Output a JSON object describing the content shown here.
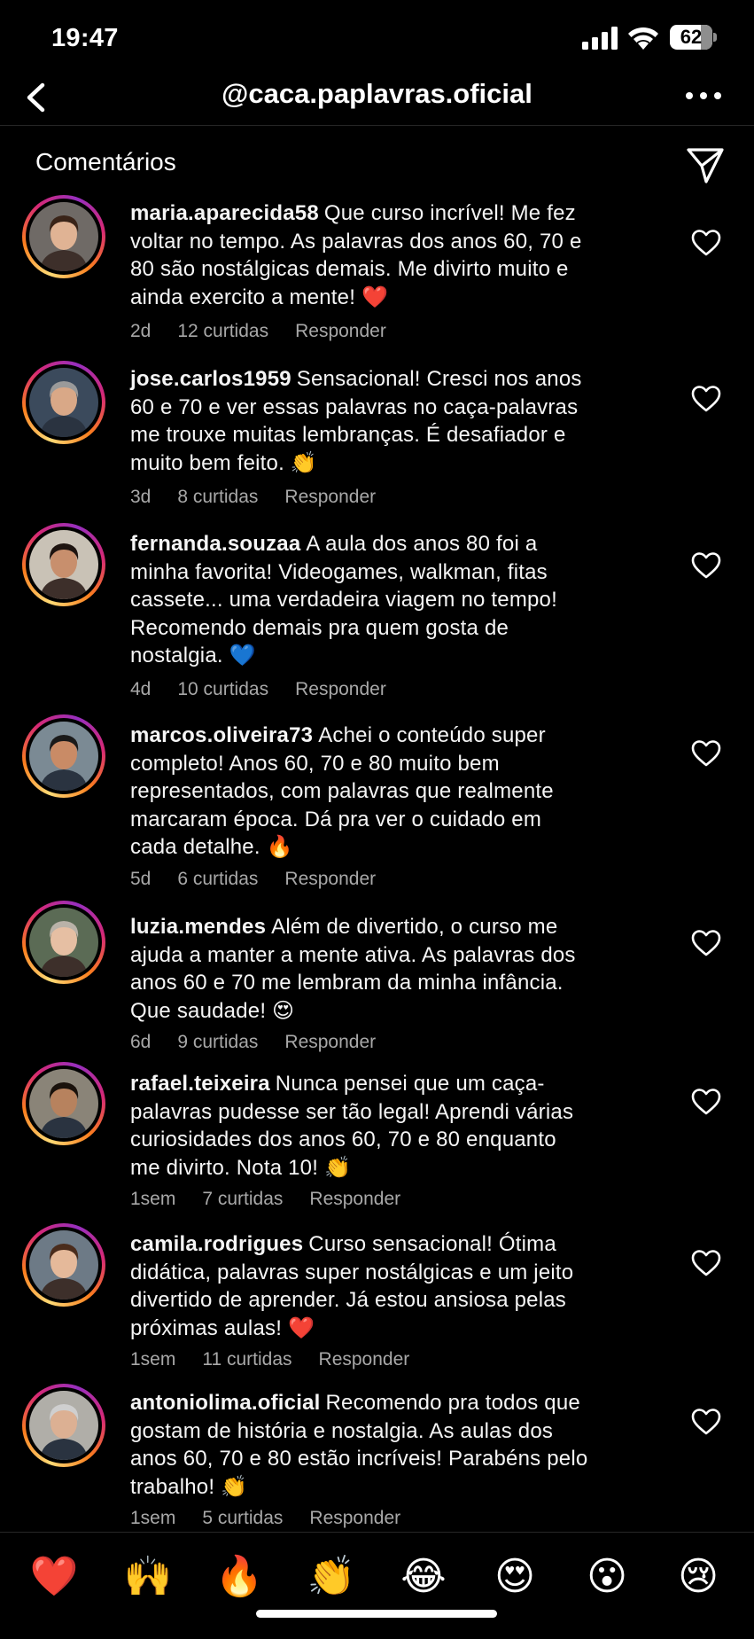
{
  "status_bar": {
    "time": "19:47",
    "battery": "62"
  },
  "header": {
    "title": "@caca.paplavras.oficial"
  },
  "section": {
    "title": "Comentários"
  },
  "comments": [
    {
      "user": "maria.aparecida58",
      "text": "Que curso incrível! Me fez voltar no tempo. As palavras dos anos 60, 70 e 80 são nostálgicas demais. Me divirto muito e ainda exercito a mente! ❤️",
      "time": "2d",
      "likes": "12 curtidas",
      "reply": "Responder"
    },
    {
      "user": "jose.carlos1959",
      "text": "Sensacional! Cresci nos anos 60 e 70 e ver essas palavras no caça-palavras me trouxe muitas lembranças. É desafiador e muito bem feito. 👏",
      "time": "3d",
      "likes": "8 curtidas",
      "reply": "Responder"
    },
    {
      "user": "fernanda.souzaa",
      "text": "A aula dos anos 80 foi a minha favorita! Videogames, walkman, fitas cassete... uma verdadeira viagem no tempo! Recomendo demais pra quem gosta de nostalgia. 💙",
      "time": "4d",
      "likes": "10 curtidas",
      "reply": "Responder"
    },
    {
      "user": "marcos.oliveira73",
      "text": "Achei o conteúdo super completo! Anos 60, 70 e 80 muito bem representados, com palavras que realmente marcaram época. Dá pra ver o cuidado em cada detalhe. 🔥",
      "time": "5d",
      "likes": "6 curtidas",
      "reply": "Responder"
    },
    {
      "user": "luzia.mendes",
      "text": "Além de divertido, o curso me ajuda a manter a mente ativa. As palavras dos anos 60 e 70 me lembram da minha infância. Que saudade! 😍",
      "time": "6d",
      "likes": "9 curtidas",
      "reply": "Responder"
    },
    {
      "user": "rafael.teixeira",
      "text": "Nunca pensei que um caça-palavras pudesse ser tão legal! Aprendi várias curiosidades dos anos 60, 70 e 80 enquanto me divirto. Nota 10! 👏",
      "time": "1sem",
      "likes": "7 curtidas",
      "reply": "Responder"
    },
    {
      "user": "camila.rodrigues",
      "text": "Curso sensacional! Ótima didática, palavras super nostálgicas e um jeito divertido de aprender. Já estou ansiosa pelas próximas aulas! ❤️",
      "time": "1sem",
      "likes": "11 curtidas",
      "reply": "Responder"
    },
    {
      "user": "antoniolima.oficial",
      "text": "Recomendo pra todos que gostam de história e nostalgia. As aulas dos anos 60, 70 e 80 estão incríveis! Parabéns pelo trabalho! 👏",
      "time": "1sem",
      "likes": "5 curtidas",
      "reply": "Responder"
    }
  ],
  "reactions": [
    "❤️",
    "🙌",
    "🔥",
    "👏",
    "😂",
    "😍",
    "😮",
    "😢"
  ],
  "icons": {
    "back": "chevron-left-icon",
    "more": "more-horizontal-icon",
    "send": "paper-plane-icon",
    "like": "heart-outline-icon"
  }
}
